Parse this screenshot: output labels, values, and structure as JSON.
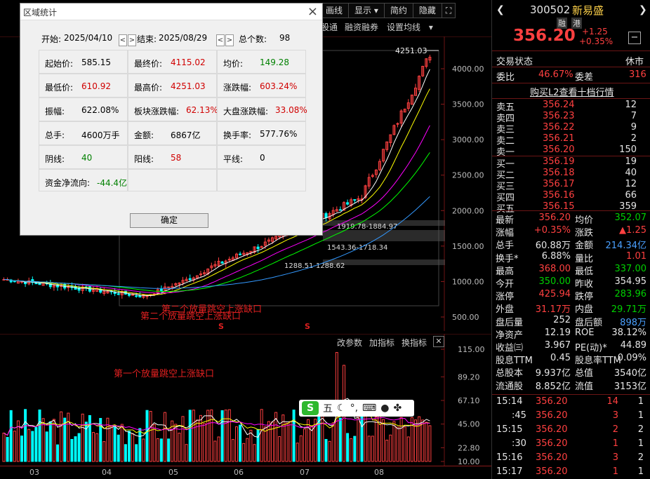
{
  "toolbar": {
    "chart_btn": "画线",
    "display_btn": "显示",
    "simple_btn": "简约",
    "hide_btn": "隐藏"
  },
  "subtoolbar": {
    "item1": "股通",
    "item2": "融资融券",
    "item3": "设置均线"
  },
  "price_axis": [
    "4000.00",
    "3500.00",
    "3000.00",
    "2500.00",
    "2000.00",
    "1500.00",
    "1000.00",
    "500.00"
  ],
  "volume_axis": [
    "115.00",
    "89.20",
    "67.10",
    "45.00",
    "22.80",
    "10.00"
  ],
  "date_axis": [
    "03",
    "04",
    "05",
    "06",
    "07",
    "08"
  ],
  "chart_labels": {
    "high_marker": "4251.03",
    "zone1": "1919.78-1884.97",
    "zone2": "1543.36-1718.34",
    "zone3": "1288.51-1288.62",
    "gap_annot_a": "第二个放量跳空上涨缺口",
    "gap_annot_b": "第二个放量跳空上涨缺口",
    "gap_annot_vol": "第一个放量跳空上涨缺口",
    "s_mark": "S"
  },
  "indicator_tabs": {
    "tab1": "改参数",
    "tab2": "加指标",
    "tab3": "换指标"
  },
  "ime": {
    "logo": "S",
    "mode": "五"
  },
  "dialog": {
    "title": "区域统计",
    "start_label": "开始:",
    "start_date": "2025/04/10",
    "end_label": "结束:",
    "end_date": "2025/08/29",
    "count_label": "总个数:",
    "count_value": "98",
    "cells": [
      {
        "label": "起始价:",
        "value": "585.15",
        "color": "black"
      },
      {
        "label": "最终价:",
        "value": "4115.02",
        "color": "red"
      },
      {
        "label": "均价:",
        "value": "149.28",
        "color": "green"
      },
      {
        "label": "最低价:",
        "value": "610.92",
        "color": "red"
      },
      {
        "label": "最高价:",
        "value": "4251.03",
        "color": "red"
      },
      {
        "label": "涨跌幅:",
        "value": "603.24%",
        "color": "red"
      },
      {
        "label": "振幅:",
        "value": "622.08%",
        "color": "black"
      },
      {
        "label": "板块涨跌幅:",
        "value": "62.13%",
        "color": "red"
      },
      {
        "label": "大盘涨跌幅:",
        "value": "33.08%",
        "color": "red"
      },
      {
        "label": "总手:",
        "value": "4600万手",
        "color": "black"
      },
      {
        "label": "金额:",
        "value": "6867亿",
        "color": "black"
      },
      {
        "label": "换手率:",
        "value": "577.76%",
        "color": "black"
      },
      {
        "label": "阴线:",
        "value": "40",
        "color": "green"
      },
      {
        "label": "阳线:",
        "value": "58",
        "color": "red"
      },
      {
        "label": "平线:",
        "value": "0",
        "color": "black"
      },
      {
        "label": "资金净流向:",
        "value": "-44.4亿",
        "color": "green"
      }
    ],
    "ok": "确定"
  },
  "stock": {
    "code": "300502",
    "name": "新易盛",
    "tag1": "融",
    "tag2": "港",
    "price": "356.20",
    "change": "+1.25",
    "change_pct": "+0.35%",
    "status_label": "交易状态",
    "status_value": "休市",
    "weibi_label": "委比",
    "weibi_value": "46.67%",
    "weicha_label": "委差",
    "weicha_value": "316",
    "l2_link": "购买L2查看十档行情"
  },
  "asks": [
    {
      "label": "卖五",
      "price": "356.24",
      "vol": "12"
    },
    {
      "label": "卖四",
      "price": "356.23",
      "vol": "7"
    },
    {
      "label": "卖三",
      "price": "356.22",
      "vol": "9"
    },
    {
      "label": "卖二",
      "price": "356.21",
      "vol": "2"
    },
    {
      "label": "卖一",
      "price": "356.20",
      "vol": "150"
    }
  ],
  "bids": [
    {
      "label": "买一",
      "price": "356.19",
      "vol": "19"
    },
    {
      "label": "买二",
      "price": "356.18",
      "vol": "40"
    },
    {
      "label": "买三",
      "price": "356.17",
      "vol": "12"
    },
    {
      "label": "买四",
      "price": "356.16",
      "vol": "66"
    },
    {
      "label": "买五",
      "price": "356.15",
      "vol": "359"
    }
  ],
  "quotes": [
    {
      "l1": "最新",
      "v1": "356.20",
      "c1": "red",
      "l2": "均价",
      "v2": "352.07",
      "c2": "green"
    },
    {
      "l1": "涨幅",
      "v1": "+0.35%",
      "c1": "red",
      "l2": "涨跌",
      "v2": "▲1.25",
      "c2": "red"
    },
    {
      "l1": "总手",
      "v1": "60.88万",
      "c1": "white",
      "l2": "金额",
      "v2": "214.34亿",
      "c2": "blue"
    },
    {
      "l1": "换手*",
      "v1": "6.88%",
      "c1": "white",
      "l2": "量比",
      "v2": "1.01",
      "c2": "red"
    },
    {
      "l1": "最高",
      "v1": "368.00",
      "c1": "red",
      "l2": "最低",
      "v2": "337.00",
      "c2": "green"
    },
    {
      "l1": "今开",
      "v1": "350.00",
      "c1": "green",
      "l2": "昨收",
      "v2": "354.95",
      "c2": "white"
    },
    {
      "l1": "涨停",
      "v1": "425.94",
      "c1": "red",
      "l2": "跌停",
      "v2": "283.96",
      "c2": "green"
    },
    {
      "l1": "外盘",
      "v1": "31.17万",
      "c1": "red",
      "l2": "内盘",
      "v2": "29.71万",
      "c2": "green"
    },
    {
      "l1": "盘后量",
      "v1": "252",
      "c1": "white",
      "l2": "盘后额",
      "v2": "898万",
      "c2": "blue"
    },
    {
      "l1": "净资产",
      "v1": "12.19",
      "c1": "white",
      "l2": "ROE",
      "v2": "38.12%",
      "c2": "white"
    },
    {
      "l1": "收益㈢",
      "v1": "3.967",
      "c1": "white",
      "l2": "PE(动)*",
      "v2": "44.89",
      "c2": "white"
    },
    {
      "l1": "股息TTM",
      "v1": "0.45",
      "c1": "white",
      "l2": "股息率TTM",
      "v2": "0.09%",
      "c2": "white"
    },
    {
      "l1": "总股本",
      "v1": "9.937亿",
      "c1": "white",
      "l2": "总值",
      "v2": "3540亿",
      "c2": "white"
    },
    {
      "l1": "流通股",
      "v1": "8.852亿",
      "c1": "white",
      "l2": "流值",
      "v2": "3153亿",
      "c2": "white"
    }
  ],
  "ticks": [
    {
      "time": "15:14",
      "price": "356.20",
      "vol": "14",
      "n": "1"
    },
    {
      "time": ":45",
      "price": "356.20",
      "vol": "3",
      "n": "1"
    },
    {
      "time": "15:15",
      "price": "356.20",
      "vol": "2",
      "n": "2"
    },
    {
      "time": ":30",
      "price": "356.20",
      "vol": "1",
      "n": "1"
    },
    {
      "time": "15:16",
      "price": "356.20",
      "vol": "3",
      "n": "2"
    },
    {
      "time": "15:17",
      "price": "356.20",
      "vol": "1",
      "n": "1"
    }
  ],
  "colors": {
    "up": "#ff4040",
    "down": "#00ffff",
    "ma5": "#ffffff",
    "ma10": "#ffff00",
    "ma20": "#ff00ff",
    "ma30": "#00ff00",
    "ma60": "#3399ff"
  }
}
